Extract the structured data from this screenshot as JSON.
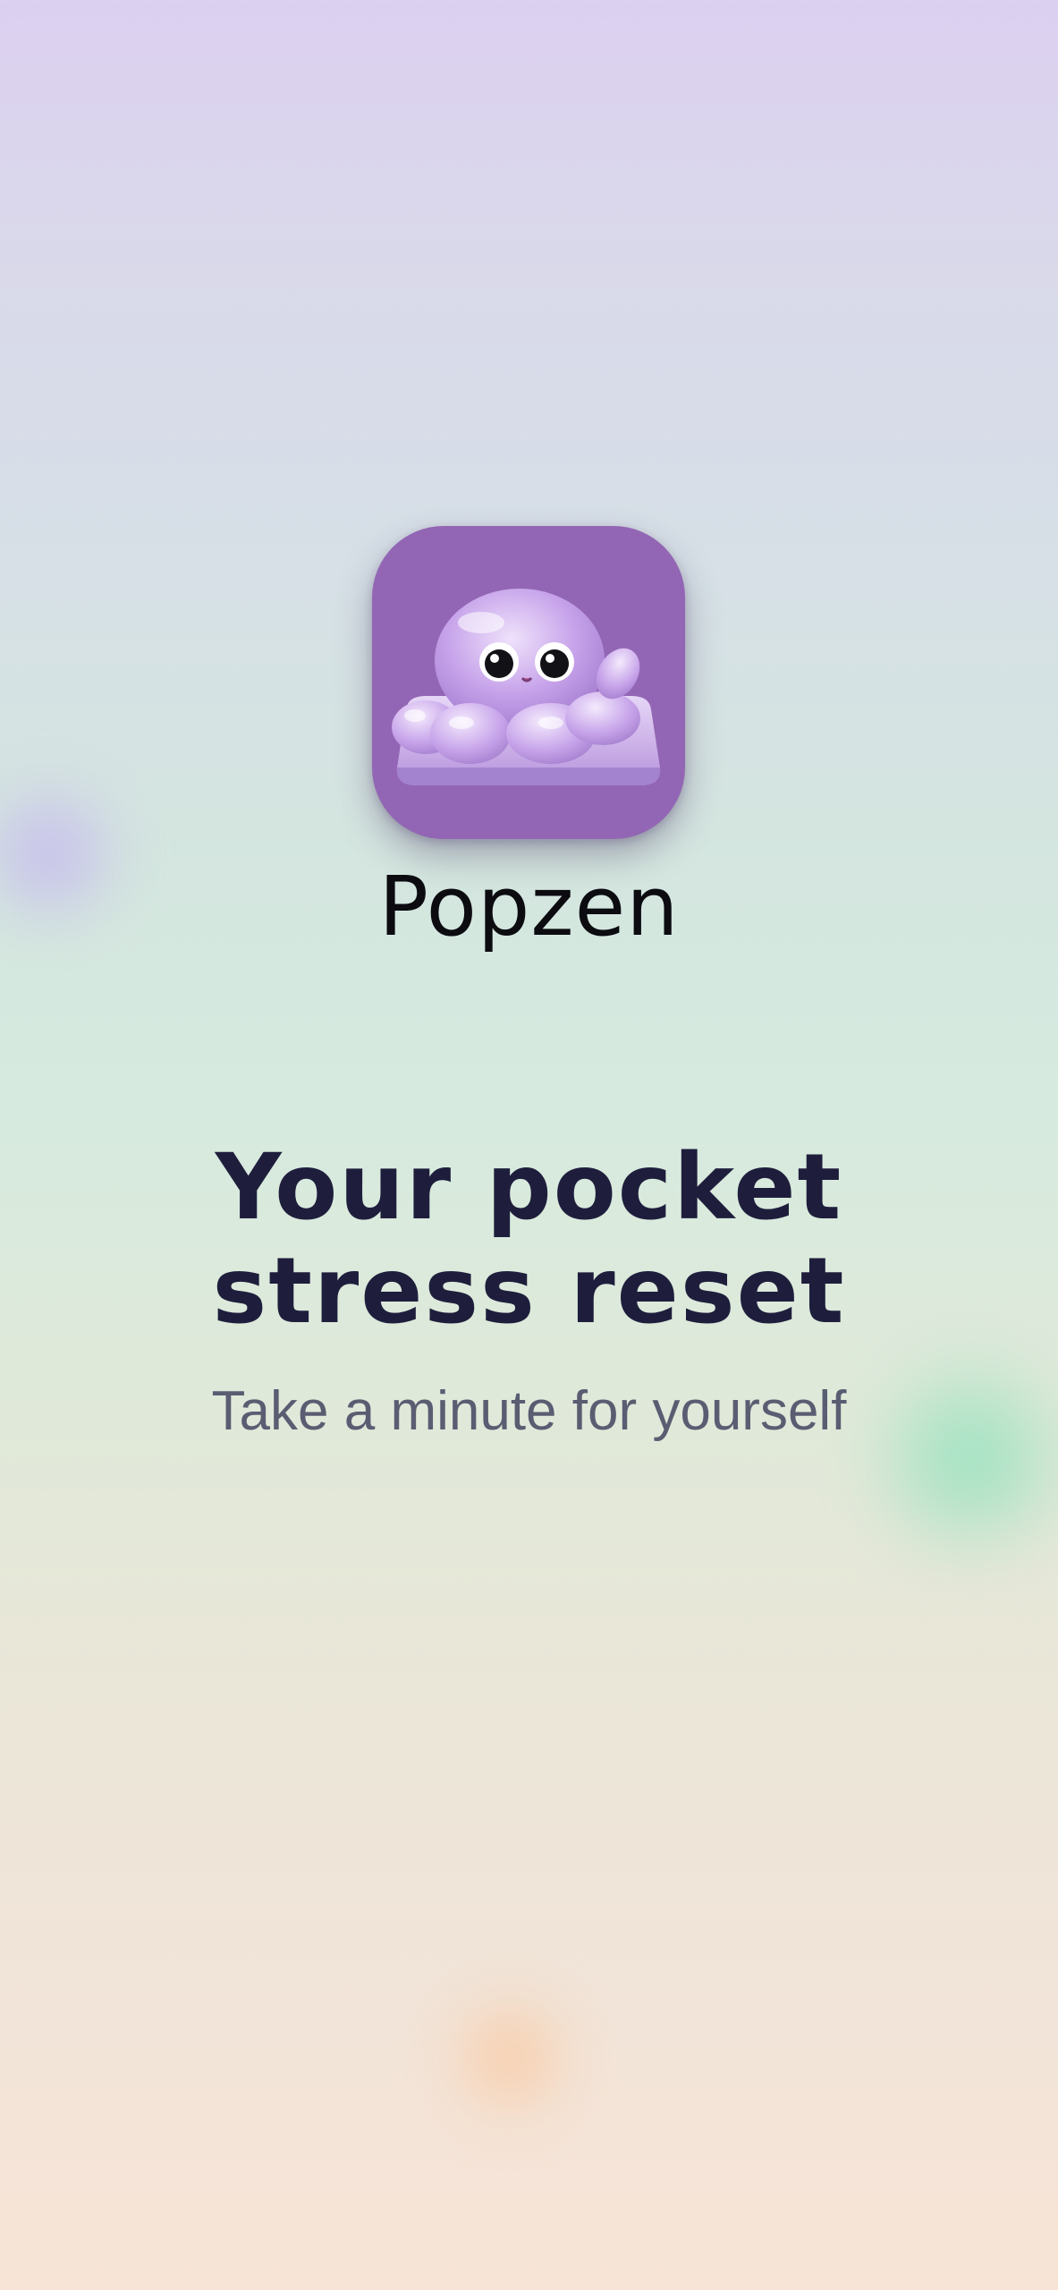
{
  "splash": {
    "app_icon": "jelly-blob-mascot-icon",
    "app_name": "Popzen",
    "headline": "Your pocket stress reset",
    "subtitle": "Take a minute for yourself"
  },
  "colors": {
    "icon_background": "#9266b4",
    "headline": "#1e1e3c",
    "subtitle": "#5a5d72",
    "blob_purple": "#c4b4f0",
    "blob_green": "#96e1be",
    "blob_orange": "#fac8a0"
  }
}
